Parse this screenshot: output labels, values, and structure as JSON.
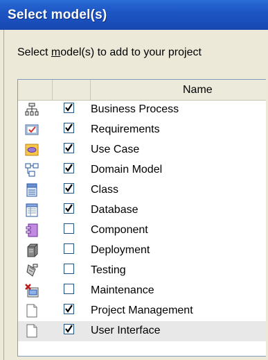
{
  "window": {
    "title": "Select model(s)"
  },
  "instruction": {
    "pre": "Select ",
    "underlined": "m",
    "post": "odel(s) to add to your project"
  },
  "table": {
    "header": {
      "name": "Name"
    },
    "rows": [
      {
        "label": "Business Process",
        "checked": true,
        "icon": "business-process-icon"
      },
      {
        "label": "Requirements",
        "checked": true,
        "icon": "requirements-icon"
      },
      {
        "label": "Use Case",
        "checked": true,
        "icon": "use-case-icon"
      },
      {
        "label": "Domain Model",
        "checked": true,
        "icon": "domain-model-icon"
      },
      {
        "label": "Class",
        "checked": true,
        "icon": "class-icon"
      },
      {
        "label": "Database",
        "checked": true,
        "icon": "database-icon"
      },
      {
        "label": "Component",
        "checked": false,
        "icon": "component-icon"
      },
      {
        "label": "Deployment",
        "checked": false,
        "icon": "deployment-icon"
      },
      {
        "label": "Testing",
        "checked": false,
        "icon": "testing-icon"
      },
      {
        "label": "Maintenance",
        "checked": false,
        "icon": "maintenance-icon"
      },
      {
        "label": "Project Management",
        "checked": true,
        "icon": "document-icon"
      },
      {
        "label": "User Interface",
        "checked": true,
        "icon": "document-icon",
        "selected": true
      }
    ]
  }
}
